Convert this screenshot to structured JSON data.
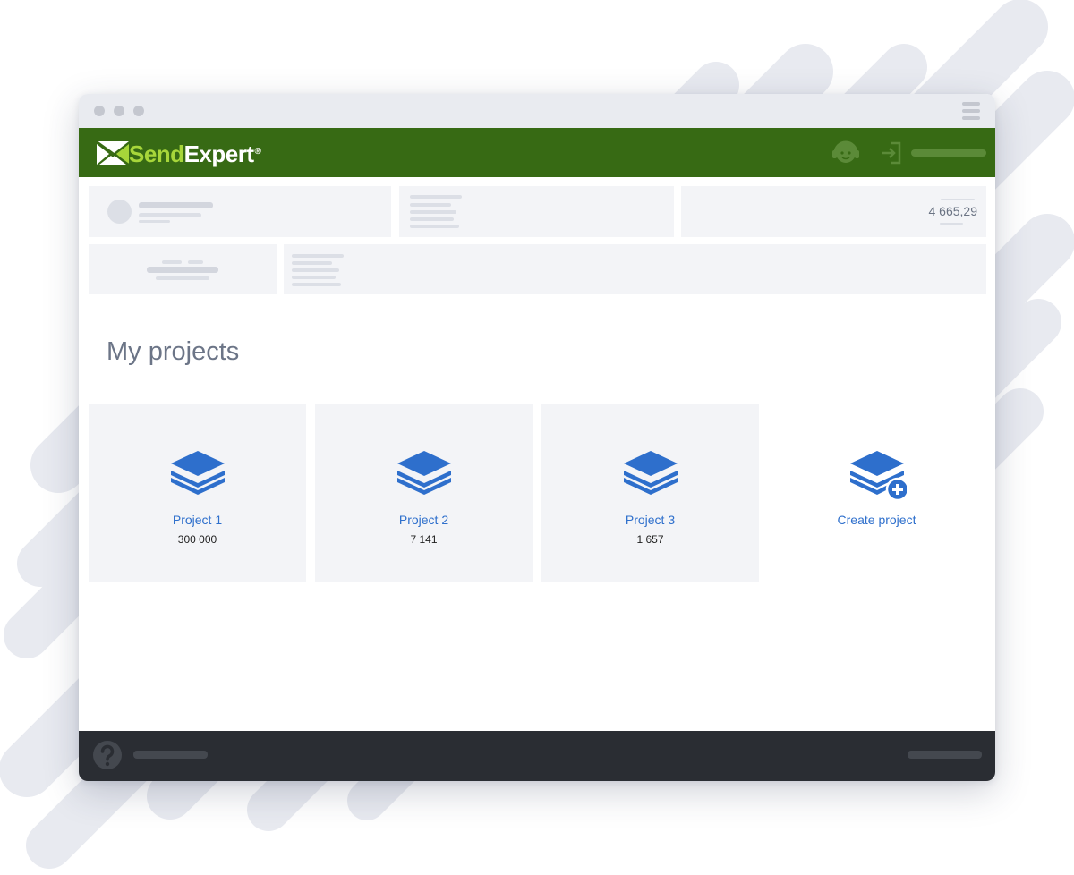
{
  "brand": {
    "name_part1": "Send",
    "name_part2": "Expert",
    "registered": "®"
  },
  "account": {
    "balance": "4 665,29"
  },
  "main": {
    "heading": "My projects"
  },
  "projects": [
    {
      "name": "Project 1",
      "count": "300 000"
    },
    {
      "name": "Project 2",
      "count": "7 141"
    },
    {
      "name": "Project 3",
      "count": "1 657"
    }
  ],
  "create_project": {
    "label": "Create project"
  },
  "icons": {
    "support": "support-agent-icon",
    "login": "login-icon",
    "project": "layers-icon",
    "create": "layers-plus-icon",
    "help": "question-mark-icon",
    "menu": "hamburger-menu-icon"
  },
  "colors": {
    "brand_green": "#376a14",
    "brand_light_green": "#a7d63a",
    "accent_blue": "#2e6fcc",
    "footer_dark": "#2a2d33"
  }
}
